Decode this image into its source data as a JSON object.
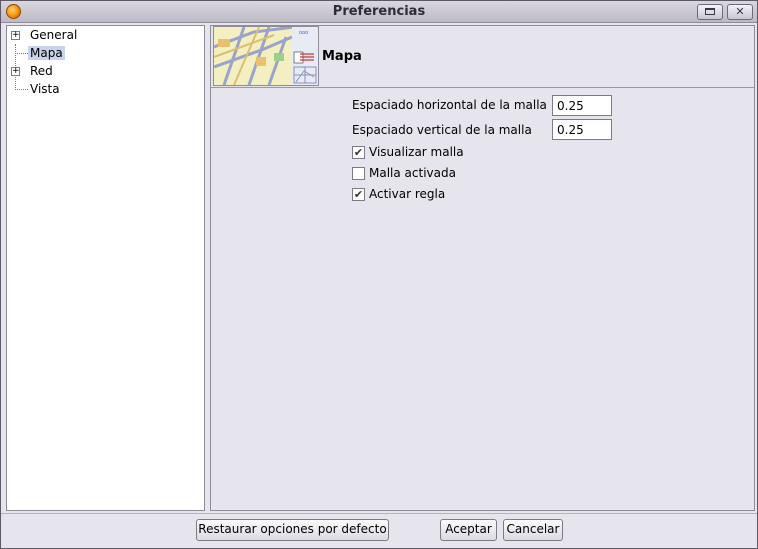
{
  "window": {
    "title": "Preferencias",
    "controls": {
      "minimize_icon": "minimize-icon",
      "close_label": "✕"
    }
  },
  "tree": {
    "items": [
      {
        "label": "General",
        "expandable": true,
        "selected": false
      },
      {
        "label": "Mapa",
        "expandable": false,
        "selected": true
      },
      {
        "label": "Red",
        "expandable": true,
        "selected": false
      },
      {
        "label": "Vista",
        "expandable": false,
        "selected": false
      }
    ],
    "expander_glyph": "+"
  },
  "panel": {
    "title": "Mapa",
    "icon": "map-thumbnail-icon",
    "fields": [
      {
        "label": "Espaciado horizontal de la malla",
        "value": "0.25"
      },
      {
        "label": "Espaciado vertical de la malla",
        "value": "0.25"
      }
    ],
    "checkboxes": [
      {
        "label": "Visualizar malla",
        "checked": true
      },
      {
        "label": "Malla activada",
        "checked": false
      },
      {
        "label": "Activar regla",
        "checked": true
      }
    ],
    "check_glyph": "✔"
  },
  "buttons": {
    "restore": "Restaurar opciones por defecto",
    "accept": "Aceptar",
    "cancel": "Cancelar"
  },
  "colors": {
    "window_bg": "#e6e4ec",
    "selection": "#c9d4ea",
    "app_icon": "#f28a00"
  }
}
